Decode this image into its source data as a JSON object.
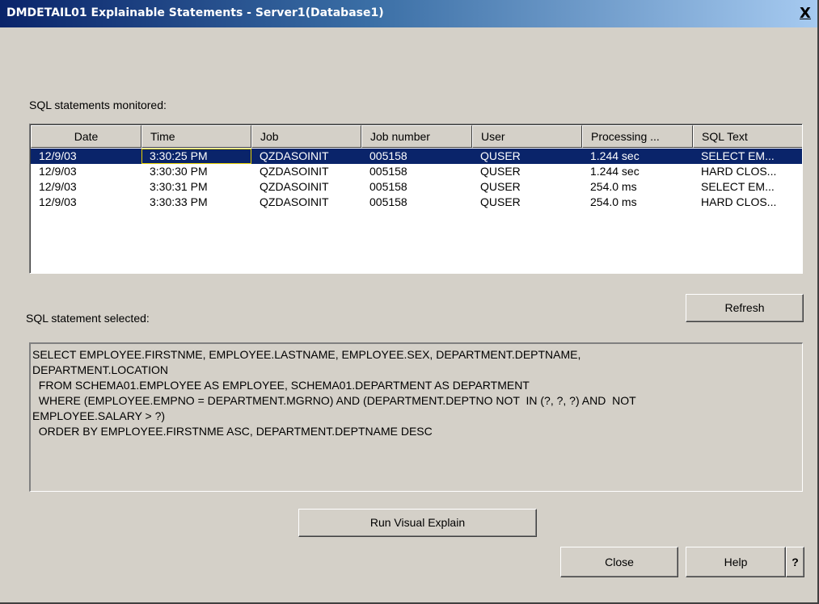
{
  "window": {
    "title": "DMDETAIL01 Explainable Statements - Server1(Database1)",
    "close_glyph": "X"
  },
  "monitored": {
    "label": "SQL statements monitored:",
    "columns": [
      "Date",
      "Time",
      "Job",
      "Job number",
      "User",
      "Processing ...",
      "SQL Text"
    ],
    "rows": [
      [
        "12/9/03",
        "3:30:25 PM",
        "QZDASOINIT",
        "005158",
        "QUSER",
        "1.244 sec",
        "SELECT EM..."
      ],
      [
        "12/9/03",
        "3:30:30 PM",
        "QZDASOINIT",
        "005158",
        "QUSER",
        "1.244 sec",
        "HARD CLOS..."
      ],
      [
        "12/9/03",
        "3:30:31 PM",
        "QZDASOINIT",
        "005158",
        "QUSER",
        "254.0 ms",
        "SELECT EM..."
      ],
      [
        "12/9/03",
        "3:30:33 PM",
        "QZDASOINIT",
        "005158",
        "QUSER",
        "254.0 ms",
        "HARD CLOS..."
      ]
    ]
  },
  "selected": {
    "label": "SQL statement selected:",
    "sql_lines": [
      "SELECT EMPLOYEE.FIRSTNME, EMPLOYEE.LASTNAME, EMPLOYEE.SEX, DEPARTMENT.DEPTNAME,",
      "DEPARTMENT.LOCATION",
      "  FROM SCHEMA01.EMPLOYEE AS EMPLOYEE, SCHEMA01.DEPARTMENT AS DEPARTMENT",
      "  WHERE (EMPLOYEE.EMPNO = DEPARTMENT.MGRNO) AND (DEPARTMENT.DEPTNO NOT  IN (?, ?, ?) AND  NOT",
      "EMPLOYEE.SALARY > ?)",
      "  ORDER BY EMPLOYEE.FIRSTNME ASC, DEPARTMENT.DEPTNAME DESC"
    ]
  },
  "buttons": {
    "refresh": "Refresh",
    "run_visual_explain": "Run Visual Explain",
    "close": "Close",
    "help": "Help",
    "context_help": "?"
  },
  "colors": {
    "selection": "#0a246a",
    "dialog_bg": "#d4d0c8"
  }
}
